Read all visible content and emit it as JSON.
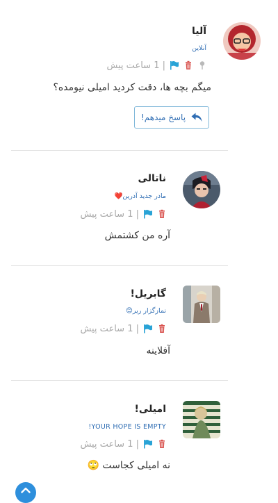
{
  "posts": [
    {
      "name": "آلیا",
      "subtitle": "آنلاین",
      "time": "| 1 ساعت پیش",
      "message": "میگم بچه ها، دقت کردید امیلی نیومده؟",
      "reply_label": "پاسخ میدهم!"
    },
    {
      "name": "ناتالی",
      "subtitle": "مادر جدید آدرین❤️",
      "time": "| 1 ساعت پیش",
      "message": "آره من کشتمش"
    },
    {
      "name": "گابریل!",
      "subtitle": "نمازگزار ریر😊",
      "time": "| 1 ساعت پیش",
      "message": "آفلاینه"
    },
    {
      "name": "امیلی!",
      "subtitle": "YOUR HOPE IS EMPTY!",
      "time": "| 1 ساعت پیش",
      "message": "نه امیلی کجاست 🙄"
    }
  ],
  "colors": {
    "accent": "#2f6db3",
    "flag": "#29a3d6",
    "trash": "#d9534f",
    "scroll_button": "#2e8fdc"
  },
  "icons": [
    "pin-icon",
    "trash-icon",
    "flag-icon",
    "reply-icon",
    "chevron-up-icon"
  ]
}
